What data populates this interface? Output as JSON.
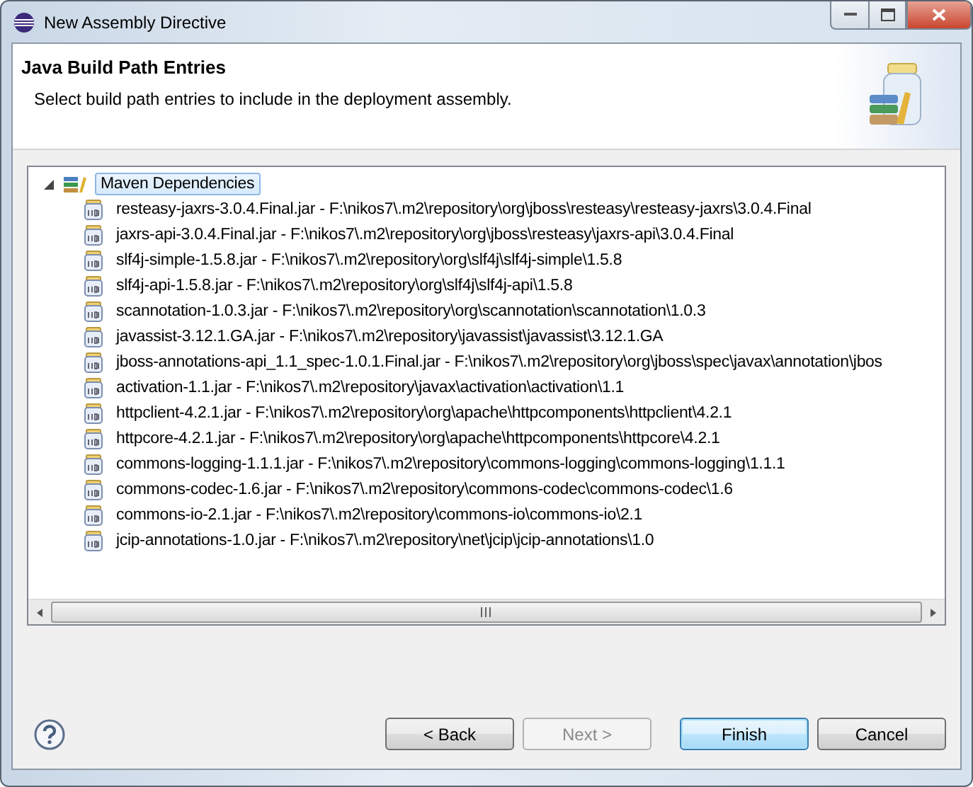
{
  "window": {
    "title": "New Assembly Directive"
  },
  "header": {
    "title": "Java Build Path Entries",
    "description": "Select build path entries to include in the deployment assembly."
  },
  "tree": {
    "root": {
      "label": "Maven Dependencies",
      "expanded": true,
      "selected": true,
      "children": [
        {
          "label": "resteasy-jaxrs-3.0.4.Final.jar - F:\\nikos7\\.m2\\repository\\org\\jboss\\resteasy\\resteasy-jaxrs\\3.0.4.Final",
          "selected": false
        },
        {
          "label": "jaxrs-api-3.0.4.Final.jar - F:\\nikos7\\.m2\\repository\\org\\jboss\\resteasy\\jaxrs-api\\3.0.4.Final",
          "selected": false
        },
        {
          "label": "slf4j-simple-1.5.8.jar - F:\\nikos7\\.m2\\repository\\org\\slf4j\\slf4j-simple\\1.5.8",
          "selected": false
        },
        {
          "label": "slf4j-api-1.5.8.jar - F:\\nikos7\\.m2\\repository\\org\\slf4j\\slf4j-api\\1.5.8",
          "selected": false
        },
        {
          "label": "scannotation-1.0.3.jar - F:\\nikos7\\.m2\\repository\\org\\scannotation\\scannotation\\1.0.3",
          "selected": false
        },
        {
          "label": "javassist-3.12.1.GA.jar - F:\\nikos7\\.m2\\repository\\javassist\\javassist\\3.12.1.GA",
          "selected": false
        },
        {
          "label": "jboss-annotations-api_1.1_spec-1.0.1.Final.jar - F:\\nikos7\\.m2\\repository\\org\\jboss\\spec\\javax\\annotation\\jbos",
          "selected": false
        },
        {
          "label": "activation-1.1.jar - F:\\nikos7\\.m2\\repository\\javax\\activation\\activation\\1.1",
          "selected": false
        },
        {
          "label": "httpclient-4.2.1.jar - F:\\nikos7\\.m2\\repository\\org\\apache\\httpcomponents\\httpclient\\4.2.1",
          "selected": false
        },
        {
          "label": "httpcore-4.2.1.jar - F:\\nikos7\\.m2\\repository\\org\\apache\\httpcomponents\\httpcore\\4.2.1",
          "selected": false
        },
        {
          "label": "commons-logging-1.1.1.jar - F:\\nikos7\\.m2\\repository\\commons-logging\\commons-logging\\1.1.1",
          "selected": false
        },
        {
          "label": "commons-codec-1.6.jar - F:\\nikos7\\.m2\\repository\\commons-codec\\commons-codec\\1.6",
          "selected": false
        },
        {
          "label": "commons-io-2.1.jar - F:\\nikos7\\.m2\\repository\\commons-io\\commons-io\\2.1",
          "selected": false
        },
        {
          "label": "jcip-annotations-1.0.jar - F:\\nikos7\\.m2\\repository\\net\\jcip\\jcip-annotations\\1.0",
          "selected": false
        }
      ]
    }
  },
  "buttons": [
    {
      "label": "< Back",
      "disabled": false,
      "default": false
    },
    {
      "label": "Next >",
      "disabled": true,
      "default": false
    },
    {
      "label": "Finish",
      "disabled": false,
      "default": true
    },
    {
      "label": "Cancel",
      "disabled": false,
      "default": false
    }
  ]
}
